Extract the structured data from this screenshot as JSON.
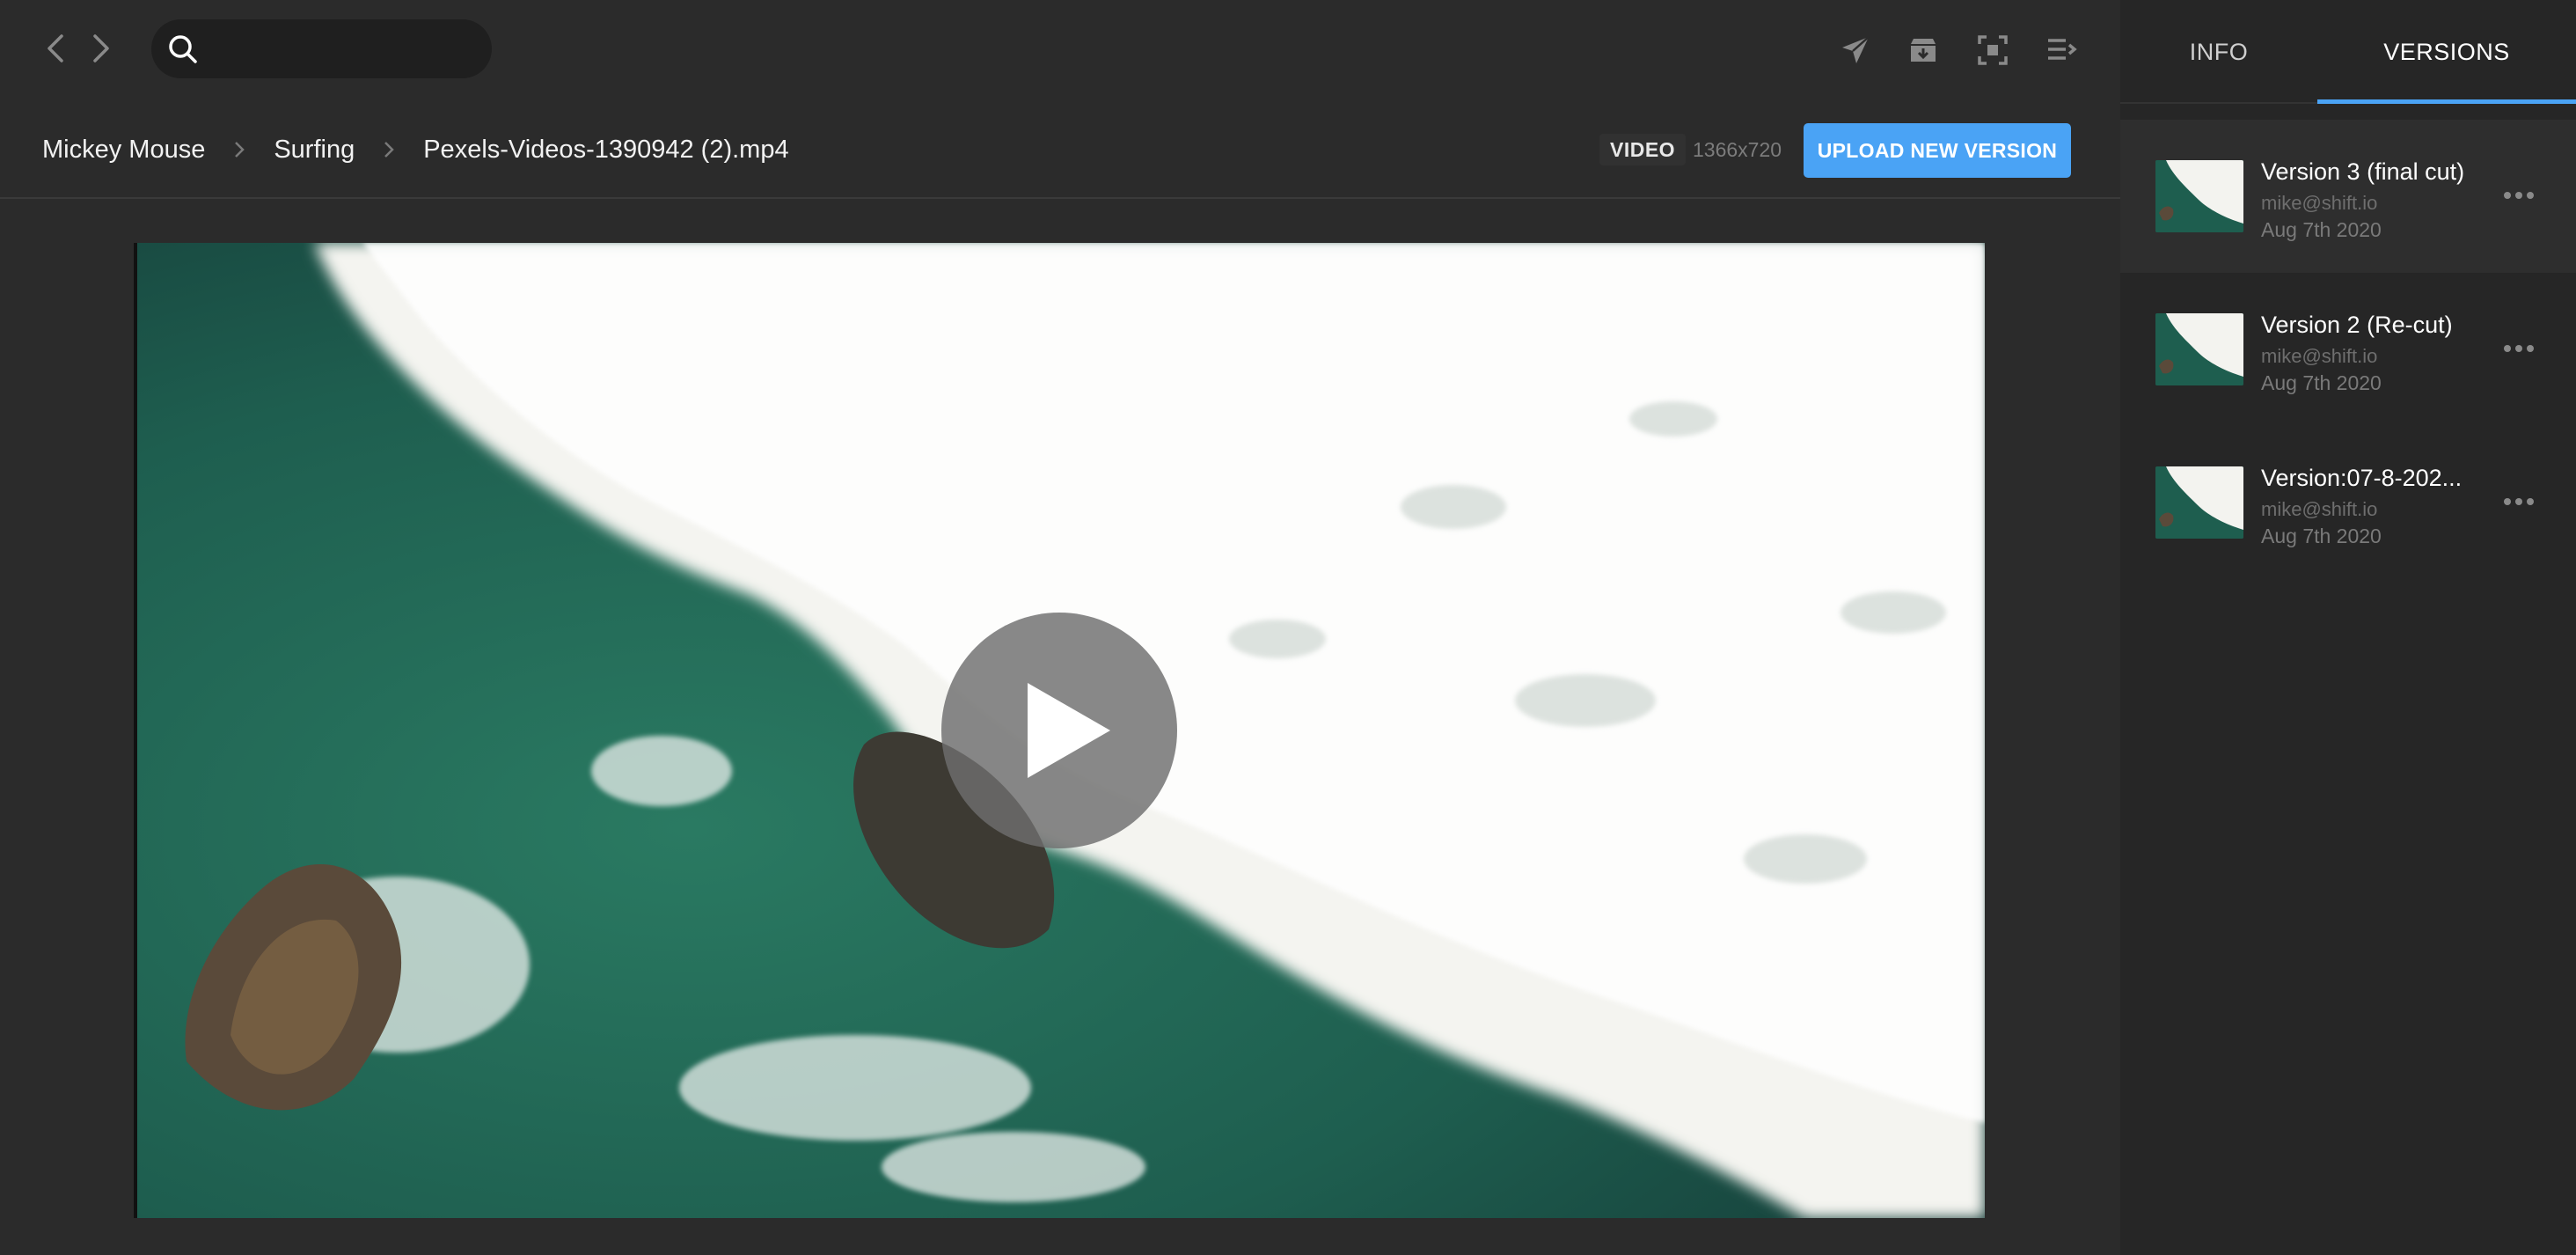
{
  "search": {
    "value": "",
    "placeholder": ""
  },
  "breadcrumb": {
    "items": [
      "Mickey Mouse",
      "Surfing",
      "Pexels-Videos-1390942 (2).mp4"
    ]
  },
  "media": {
    "type_badge": "VIDEO",
    "dimensions": "1366x720"
  },
  "actions": {
    "upload_label": "UPLOAD NEW VERSION"
  },
  "toolbar_icons": [
    "send-icon",
    "archive-icon",
    "focus-icon",
    "list-icon"
  ],
  "tabs": [
    {
      "label": "INFO",
      "active": false
    },
    {
      "label": "VERSIONS",
      "active": true
    }
  ],
  "versions": [
    {
      "title": "Version 3 (final cut)",
      "author": "mike@shift.io",
      "date": "Aug 7th 2020",
      "selected": true
    },
    {
      "title": "Version 2 (Re-cut)",
      "author": "mike@shift.io",
      "date": "Aug 7th 2020",
      "selected": false
    },
    {
      "title": "Version:07-8-202...",
      "author": "mike@shift.io",
      "date": "Aug 7th 2020",
      "selected": false
    }
  ],
  "colors": {
    "accent": "#4aa3f5",
    "background": "#2b2b2b",
    "panel": "#262626",
    "sea": "#1d5a4c",
    "foam": "#f4f4f0"
  }
}
